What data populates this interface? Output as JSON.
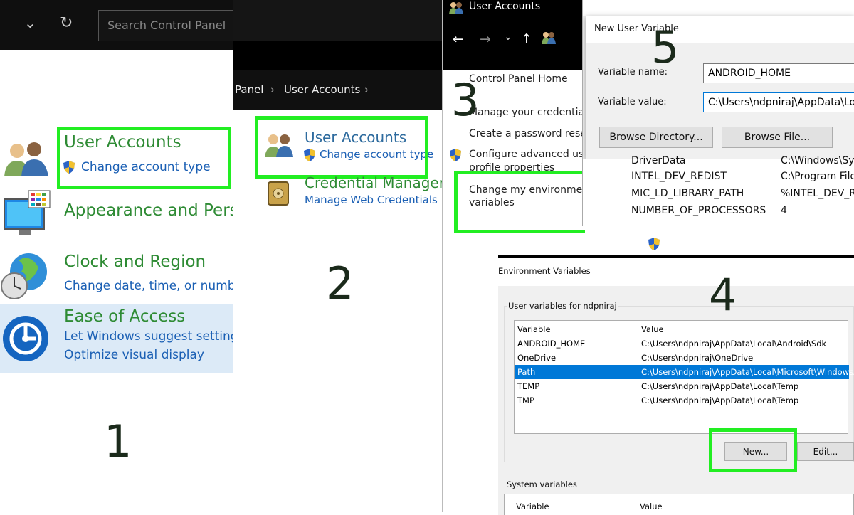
{
  "panel1": {
    "search_placeholder": "Search Control Panel",
    "categories": [
      {
        "title": "User Accounts",
        "links": [
          "Change account type"
        ]
      },
      {
        "title": "Appearance and Perso",
        "links": []
      },
      {
        "title": "Clock and Region",
        "links": [
          "Change date, time, or numbe"
        ]
      },
      {
        "title": "Ease of Access",
        "links": [
          "Let Windows suggest settings",
          "Optimize visual display"
        ]
      }
    ],
    "step": "1"
  },
  "panel2": {
    "breadcrumb": [
      "Panel",
      "User Accounts"
    ],
    "items": [
      {
        "title": "User Accounts",
        "link": "Change account type"
      },
      {
        "title": "Credential Manager",
        "link": "Manage Web Credentials"
      }
    ],
    "step": "2"
  },
  "panel3": {
    "window_title": "User Accounts",
    "links": [
      "Control Panel Home",
      "Manage your credentia",
      "Create a password rese",
      "Configure advanced us",
      "profile properties",
      "Change my environme",
      "variables"
    ],
    "step": "3"
  },
  "panel5": {
    "dialog_title": "New User Variable",
    "name_label": "Variable name:",
    "name_value": "ANDROID_HOME",
    "value_label": "Variable value:",
    "value_value": "C:\\Users\\ndpniraj\\AppData\\Local\\Android\\Sdk",
    "browse_dir": "Browse Directory...",
    "browse_file": "Browse File...",
    "bg_rows": [
      {
        "name": "DriverData",
        "value": "C:\\Windows\\Sy"
      },
      {
        "name": "INTEL_DEV_REDIST",
        "value": "C:\\Program File"
      },
      {
        "name": "MIC_LD_LIBRARY_PATH",
        "value": "%INTEL_DEV_RE"
      },
      {
        "name": "NUMBER_OF_PROCESSORS",
        "value": "4"
      }
    ],
    "step": "5"
  },
  "panel4": {
    "dialog_title": "Environment Variables",
    "user_group": "User variables for ndpniraj",
    "col_variable": "Variable",
    "col_value": "Value",
    "rows": [
      {
        "name": "ANDROID_HOME",
        "value": "C:\\Users\\ndpniraj\\AppData\\Local\\Android\\Sdk"
      },
      {
        "name": "OneDrive",
        "value": "C:\\Users\\ndpniraj\\OneDrive"
      },
      {
        "name": "Path",
        "value": "C:\\Users\\ndpniraj\\AppData\\Local\\Microsoft\\WindowsApps"
      },
      {
        "name": "TEMP",
        "value": "C:\\Users\\ndpniraj\\AppData\\Local\\Temp"
      },
      {
        "name": "TMP",
        "value": "C:\\Users\\ndpniraj\\AppData\\Local\\Temp"
      }
    ],
    "new_label": "New...",
    "edit_label": "Edit...",
    "system_group": "System variables",
    "sys_col_variable": "Variable",
    "sys_col_value": "Value",
    "step": "4"
  },
  "colors": {
    "highlight": "#22ee22",
    "link": "#1a5fb4",
    "category": "#2e8b34",
    "selection": "#0078d7"
  }
}
